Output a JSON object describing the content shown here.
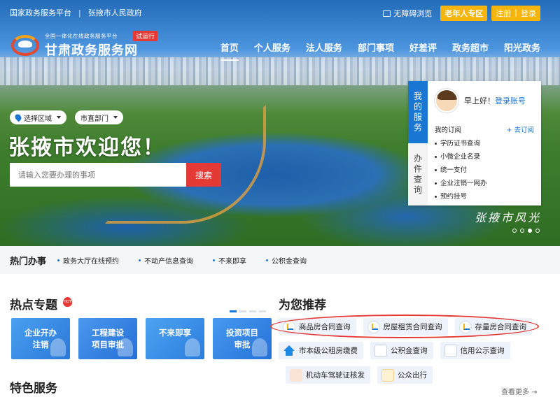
{
  "topbar": {
    "platform": "国家政务服务平台",
    "separator": "|",
    "city_gov": "张掖市人民政府",
    "accessibility": "无障碍浏览",
    "elder": "老年人专区",
    "register": "注册",
    "login": "登录"
  },
  "logo": {
    "subtitle": "全国一体化在线政务服务平台",
    "title": "甘肃政务服务网",
    "trial_badge": "试运行"
  },
  "nav": {
    "items": [
      "首页",
      "个人服务",
      "法人服务",
      "部门事项",
      "好差评",
      "政务超市",
      "阳光政务"
    ],
    "active": 0
  },
  "selectors": {
    "region": "选择区域",
    "dept": "市直部门"
  },
  "hero": {
    "welcome": "张掖市欢迎您！",
    "search_placeholder": "请输入您要办理的事项",
    "search_button": "搜索",
    "slogan": "张掖市风光",
    "carousel_count": 4,
    "carousel_active": 2
  },
  "panel": {
    "tab_my": "我的服务",
    "tab_query": "办件查询",
    "greeting": "早上好！",
    "login_link": "登录账号",
    "subscription_title": "我的订阅",
    "subscribe": "+ 去订阅",
    "items": [
      "学历证书查询",
      "小微企业名录",
      "统一支付",
      "企业注销一网办",
      "预约挂号"
    ]
  },
  "hot": {
    "title": "热门办事",
    "links": [
      "政务大厅在线预约",
      "不动产信息查询",
      "不来即享",
      "公积金查询"
    ]
  },
  "topics": {
    "title": "热点专题",
    "badge": "HOT",
    "cards": [
      {
        "label1": "企业开办",
        "label2": "注销",
        "color": "#3a8ee6"
      },
      {
        "label1": "工程建设",
        "label2": "项目审批",
        "color": "#2f7fe0"
      },
      {
        "label1": "不来即享",
        "label2": "",
        "color": "#3b8fe8"
      },
      {
        "label1": "投资项目",
        "label2": "审批",
        "color": "#3286e2"
      }
    ]
  },
  "recommend": {
    "title": "为您推荐",
    "row1": [
      "商品房合同查询",
      "房屋租赁合同查询",
      "存量房合同查询"
    ],
    "row2": [
      "市本级公租房缴费",
      "公积金查询",
      "信用公示查询"
    ],
    "row3": [
      "机动车驾驶证核发",
      "公众出行"
    ],
    "more": "查看更多"
  },
  "featured": {
    "title": "特色服务"
  }
}
